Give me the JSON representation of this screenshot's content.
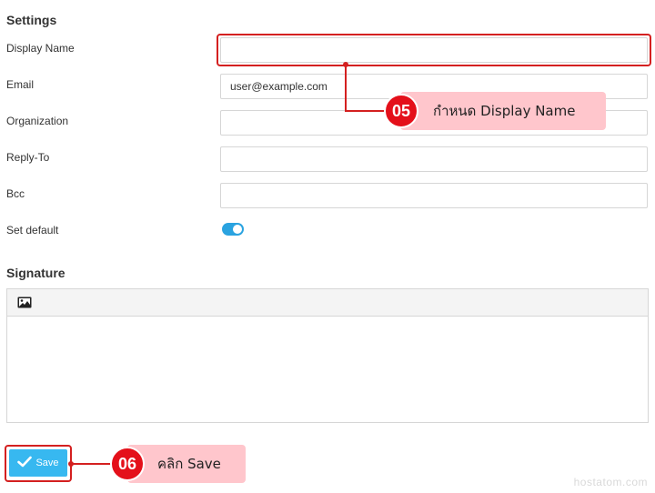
{
  "settings": {
    "title": "Settings",
    "fields": [
      {
        "label": "Display Name",
        "value": ""
      },
      {
        "label": "Email",
        "value": "user@example.com"
      },
      {
        "label": "Organization",
        "value": ""
      },
      {
        "label": "Reply-To",
        "value": ""
      },
      {
        "label": "Bcc",
        "value": ""
      }
    ],
    "set_default": {
      "label": "Set default",
      "on": true
    }
  },
  "signature": {
    "title": "Signature",
    "toolbar_icon": "image-icon"
  },
  "save_button": {
    "label": "Save",
    "icon": "check-icon"
  },
  "annotations": [
    {
      "number": "05",
      "text": "กำหนด Display Name"
    },
    {
      "number": "06",
      "text": "คลิก Save"
    }
  ],
  "watermark": "hostatom.com",
  "colors": {
    "highlight": "#d42020",
    "badge": "#e4101a",
    "callout": "#ffc6cc",
    "toggle_on": "#2aa3e0",
    "save_button": "#37b8f0"
  }
}
